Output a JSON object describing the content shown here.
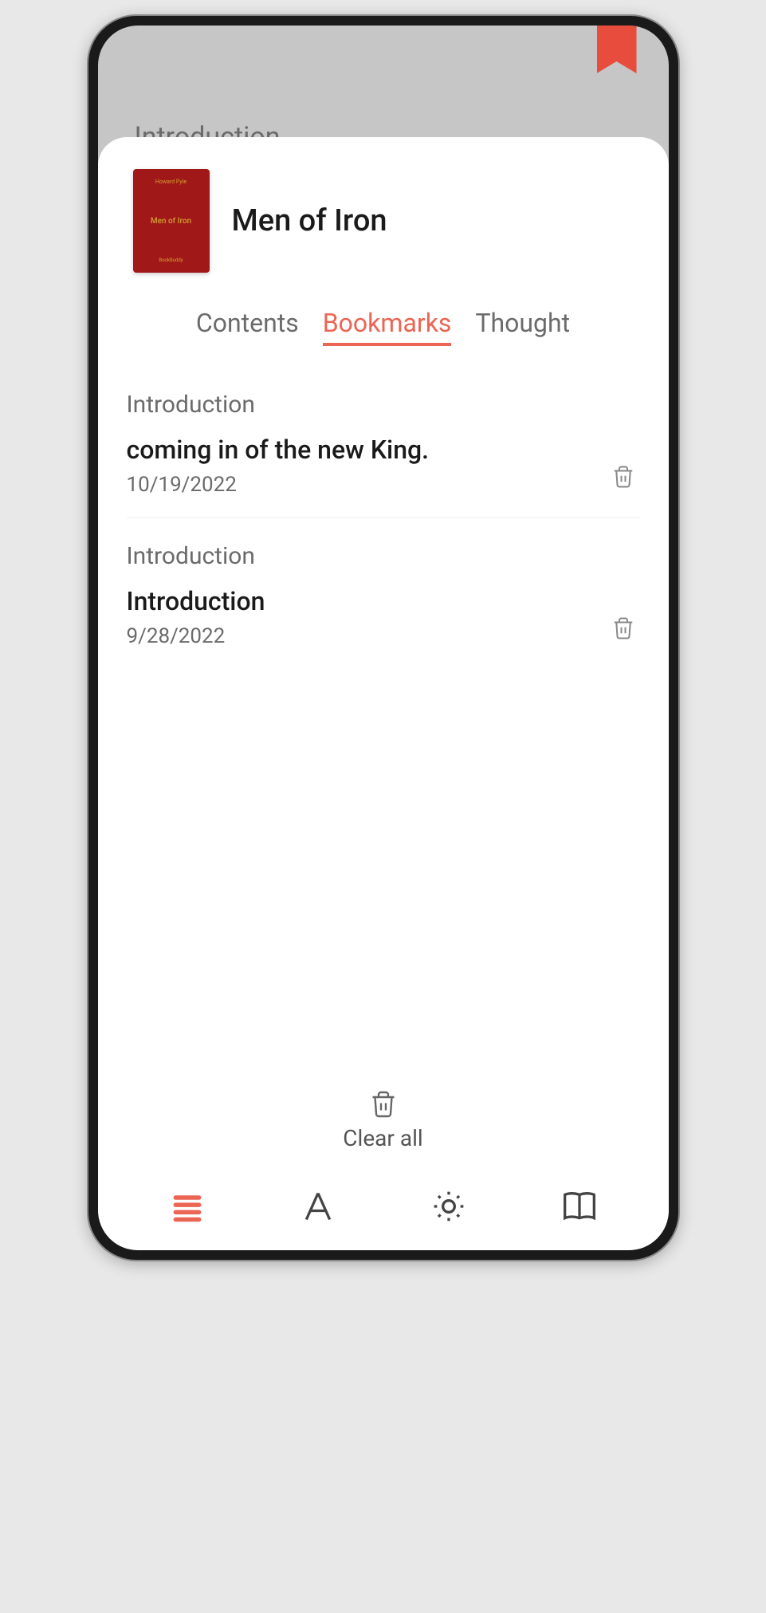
{
  "background": {
    "chapter_hint": "Introduction"
  },
  "book": {
    "title": "Men of Iron",
    "cover_author": "Howard Pyle",
    "cover_title": "Men of Iron",
    "cover_publisher": "BookBuddy"
  },
  "tabs": {
    "contents": "Contents",
    "bookmarks": "Bookmarks",
    "thought": "Thought"
  },
  "bookmarks": [
    {
      "chapter": "Introduction",
      "excerpt": "coming in of the new King.",
      "date": "10/19/2022"
    },
    {
      "chapter": "Introduction",
      "excerpt": "Introduction",
      "date": "9/28/2022"
    }
  ],
  "footer": {
    "clear_all": "Clear all"
  },
  "colors": {
    "accent": "#ec6453",
    "cover": "#a01818"
  }
}
